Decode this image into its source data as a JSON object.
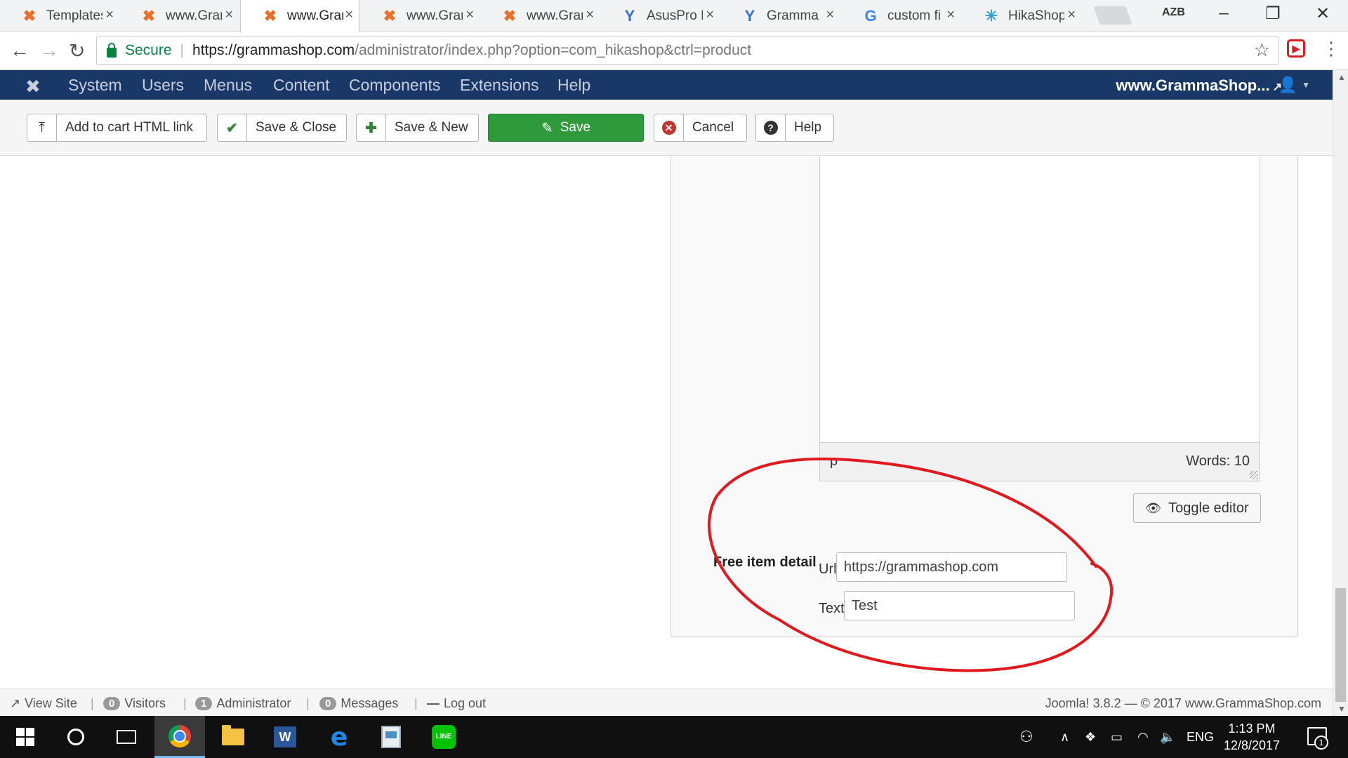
{
  "browser": {
    "tabs": [
      {
        "title": "Templates",
        "icon": "joomla-icon",
        "active": false
      },
      {
        "title": "www.Gram",
        "icon": "joomla-icon",
        "active": false
      },
      {
        "title": "www.Gram",
        "icon": "joomla-icon",
        "active": true
      },
      {
        "title": "www.Gram",
        "icon": "joomla-icon",
        "active": false
      },
      {
        "title": "www.Gram",
        "icon": "joomla-icon",
        "active": false
      },
      {
        "title": "AsusPro B",
        "icon": "yandex-icon",
        "active": false
      },
      {
        "title": "Gramma S",
        "icon": "yandex-icon",
        "active": false
      },
      {
        "title": "custom fi",
        "icon": "google-icon",
        "active": false
      },
      {
        "title": "HikaShop",
        "icon": "hikashop-icon",
        "active": false
      }
    ],
    "tab_close": "×",
    "window_label": "AZB",
    "secure_label": "Secure",
    "url_host": "https://grammashop.com",
    "url_path": "/administrator/index.php?option=com_hikashop&ctrl=product"
  },
  "admin_nav": {
    "logo": "✖",
    "items": [
      "System",
      "Users",
      "Menus",
      "Content",
      "Components",
      "Extensions",
      "Help"
    ],
    "site_name": "www.GrammaShop...",
    "site_link_icon": "↗"
  },
  "toolbar": {
    "add_to_cart": "Add to cart HTML link",
    "save_close": "Save & Close",
    "save_new": "Save & New",
    "save": "Save",
    "cancel": "Cancel",
    "help": "Help"
  },
  "editor": {
    "path": "p",
    "words": "Words: 10",
    "toggle_label": "Toggle editor"
  },
  "free_item": {
    "section_label": "Free item detail",
    "url_label": "Url",
    "url_value": "https://grammashop.com",
    "text_label": "Text",
    "text_value": "Test"
  },
  "annotation": {
    "color": "#e0191f"
  },
  "statusbar": {
    "view_site": "View Site",
    "visitors_count": "0",
    "visitors_label": "Visitors",
    "admin_count": "1",
    "admin_label": "Administrator",
    "messages_count": "0",
    "messages_label": "Messages",
    "logout": "Log out",
    "version": "Joomla! 3.8.2 — © 2017 www.GrammaShop.com"
  },
  "taskbar": {
    "language": "ENG",
    "time": "1:13 PM",
    "date": "12/8/2017",
    "notification_count": "1"
  },
  "colors": {
    "admin_nav_bg": "#1a3867",
    "save_green": "#2f9a3c",
    "cancel_red": "#bd362f",
    "secure_green": "#0b8043"
  }
}
